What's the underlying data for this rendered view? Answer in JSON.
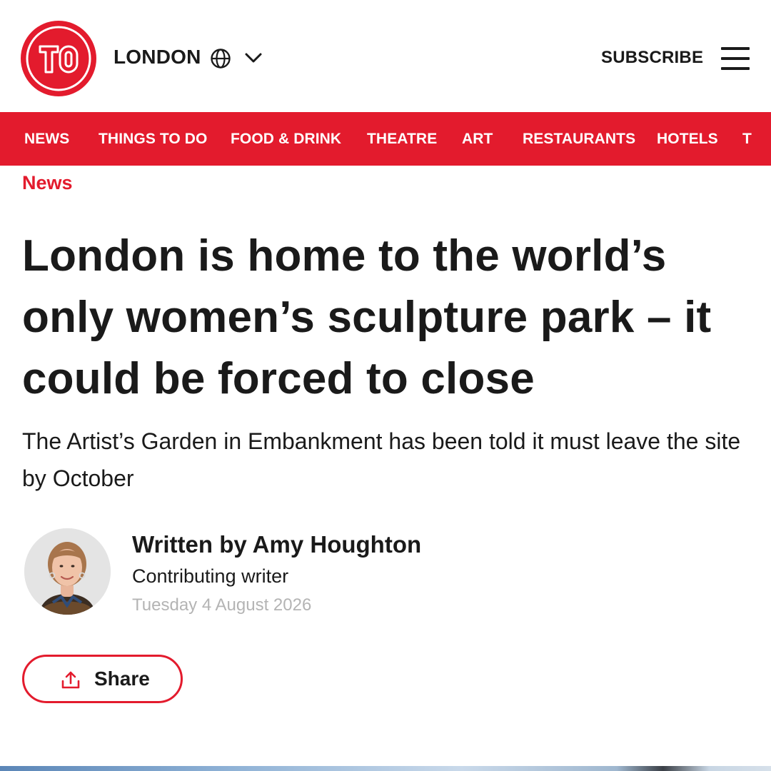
{
  "header": {
    "logo_text": "TO",
    "city": "LONDON",
    "subscribe_label": "SUBSCRIBE"
  },
  "nav": {
    "items": [
      "NEWS",
      "THINGS TO DO",
      "FOOD & DRINK",
      "THEATRE",
      "ART",
      "RESTAURANTS",
      "HOTELS",
      "T"
    ]
  },
  "article": {
    "kicker": "News",
    "headline": "London is home to the world’s only women’s sculpture park – it could be forced to close",
    "standfirst": "The Artist’s Garden in Embankment has been told it must leave the site by October",
    "author": {
      "byline": "Written by Amy Houghton",
      "role": "Contributing writer",
      "date": "Tuesday 4 August 2026"
    },
    "share_label": "Share"
  },
  "colors": {
    "brand_red": "#e31b2d",
    "text": "#1a1a1a",
    "muted": "#b4b4b4"
  },
  "icons": [
    "globe-icon",
    "chevron-down-icon",
    "hamburger-menu-icon",
    "share-icon"
  ]
}
